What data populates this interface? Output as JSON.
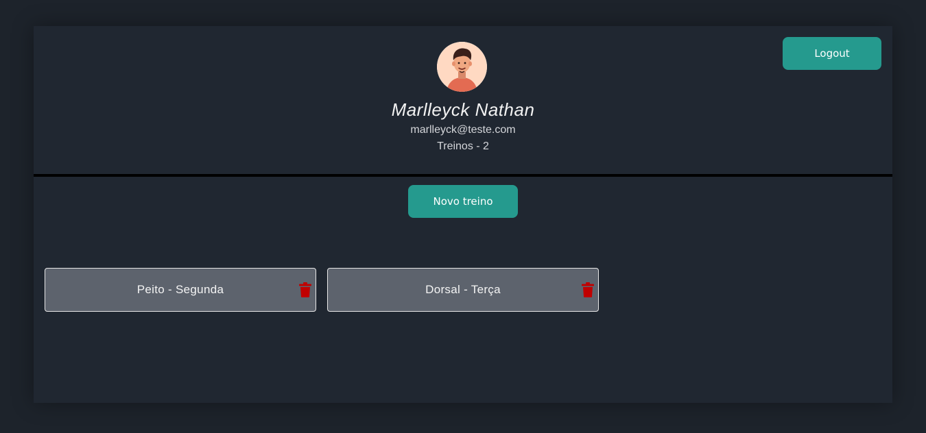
{
  "header": {
    "avatar_icon": "user-avatar-icon",
    "user_name": "Marlleyck Nathan",
    "email": "marlleyck@teste.com",
    "workout_count": "Treinos - 2",
    "logout_label": "Logout"
  },
  "main": {
    "new_workout_label": "Novo treino",
    "workouts": [
      {
        "title": "Peito - Segunda",
        "delete_icon": "trash-icon"
      },
      {
        "title": "Dorsal - Terça",
        "delete_icon": "trash-icon"
      }
    ]
  },
  "colors": {
    "background": "#1d232b",
    "panel": "#202731",
    "accent": "#259a8e",
    "card": "#5d636d",
    "danger": "#c00000"
  }
}
